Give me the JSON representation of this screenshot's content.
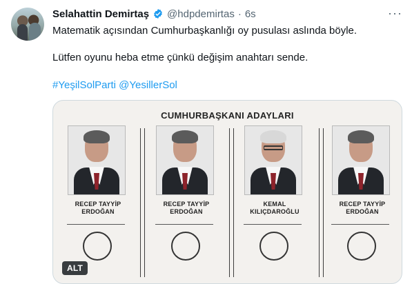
{
  "tweet": {
    "author_name": "Selahattin Demirtaş",
    "handle": "@hdpdemirtas",
    "separator": "·",
    "time": "6s",
    "more_label": "···",
    "line1": "Matematik açısından Cumhurbaşkanlığı oy pusulası aslında böyle.",
    "line2": "Lütfen oyunu heba etme çünkü değişim anahtarı sende.",
    "hashtags": "#YeşilSolParti @YesillerSol",
    "verified_icon": "verified-badge-icon",
    "accent_color": "#1d9bf0"
  },
  "ballot": {
    "title": "CUMHURBAŞKANI ADAYLARI",
    "candidates": [
      {
        "name": "RECEP TAYYİP\nERDOĞAN"
      },
      {
        "name": "RECEP TAYYİP\nERDOĞAN"
      },
      {
        "name": "KEMAL\nKILIÇDAROĞLU"
      },
      {
        "name": "RECEP TAYYİP\nERDOĞAN"
      }
    ]
  },
  "media": {
    "alt_label": "ALT"
  }
}
